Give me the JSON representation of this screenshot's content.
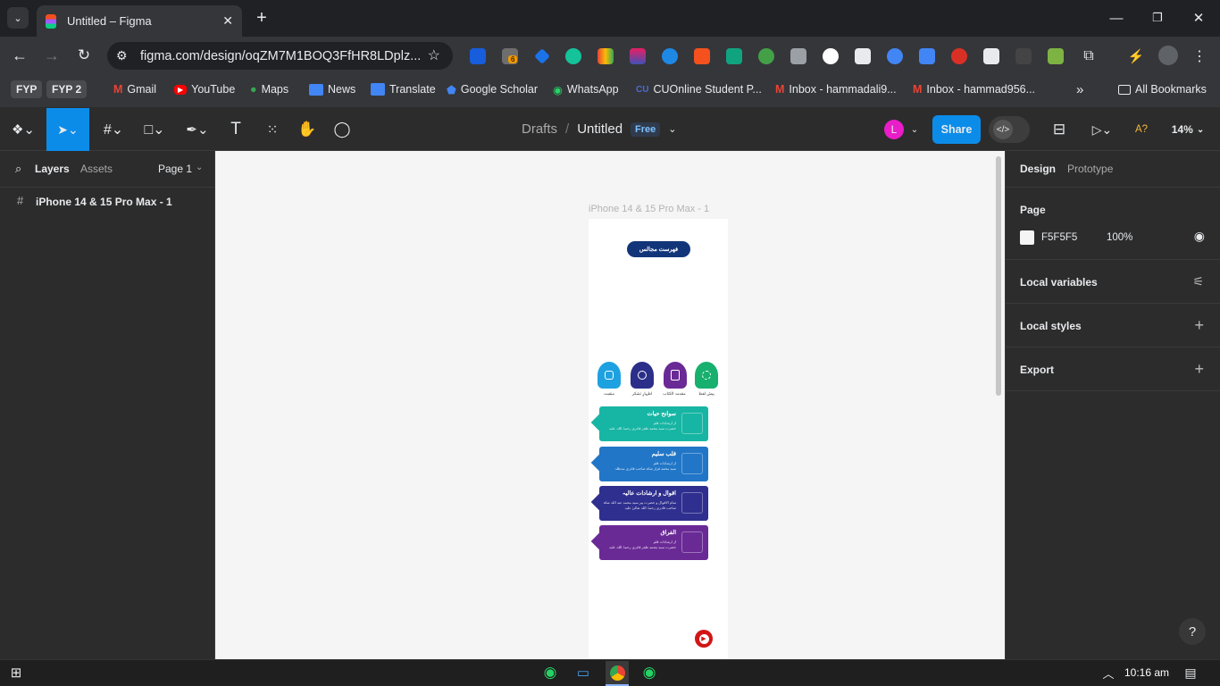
{
  "browser": {
    "tab_title": "Untitled – Figma",
    "url": "figma.com/design/oqZM7M1BOQ3FfHR8LDplz...",
    "ext_badge": "6",
    "bookmarks": [
      "FYP",
      "FYP 2",
      "Gmail",
      "YouTube",
      "Maps",
      "News",
      "Translate",
      "Google Scholar",
      "WhatsApp",
      "CUOnline Student P...",
      "Inbox - hammadali9...",
      "Inbox - hammad956...",
      "All Bookmarks"
    ]
  },
  "figma": {
    "breadcrumb_root": "Drafts",
    "file_name": "Untitled",
    "plan_badge": "Free",
    "avatar_letter": "L",
    "share_label": "Share",
    "ai_label": "A?",
    "zoom": "14%",
    "left": {
      "tab_layers": "Layers",
      "tab_assets": "Assets",
      "page_select": "Page 1",
      "layer_name": "iPhone 14 & 15 Pro Max - 1"
    },
    "right": {
      "tab_design": "Design",
      "tab_prototype": "Prototype",
      "page_heading": "Page",
      "page_color": "F5F5F5",
      "page_opacity": "100%",
      "local_variables": "Local variables",
      "local_styles": "Local styles",
      "export": "Export"
    },
    "help": "?"
  },
  "frame": {
    "label": "iPhone 14 & 15 Pro Max - 1",
    "header_title": "فهرست مجالس",
    "categories": [
      "منقبت",
      "اظہارِ تشکر",
      "مقدمہ الکتاب",
      "پیش لفظ"
    ],
    "cards": [
      {
        "title": "سوانح حیات",
        "line1": "از ارشادات قلم",
        "line2": "حضرت سید محمد ظفر قادری رحمۃ اللہ علیہ",
        "color": "#17b5a3"
      },
      {
        "title": "قلب سلیم",
        "line1": "از ارشادات قلم",
        "line2": "سید محمد فراز شاہ صاحب قادری مدظلہ",
        "color": "#2176c7"
      },
      {
        "title": "اقوال و ارشادات عالیہ",
        "line1": "تمام الاقوال و حضرت پیر سید محمد عبد اللہ شاہ",
        "line2": "صاحب قادری رحمۃ اللہ تعالیٰ علیہ",
        "color": "#2f2f8f"
      },
      {
        "title": "الفراق",
        "line1": "از ارشادات قلم",
        "line2": "حضرت سید محمد ظفر قادری رحمۃ اللہ علیہ",
        "color": "#6a2a96"
      }
    ],
    "category_colors": [
      "#1ea1e0",
      "#2b2f8a",
      "#6a2a96",
      "#17b06e"
    ],
    "header_color": "#12357a"
  },
  "taskbar": {
    "time": "10:16 am"
  }
}
